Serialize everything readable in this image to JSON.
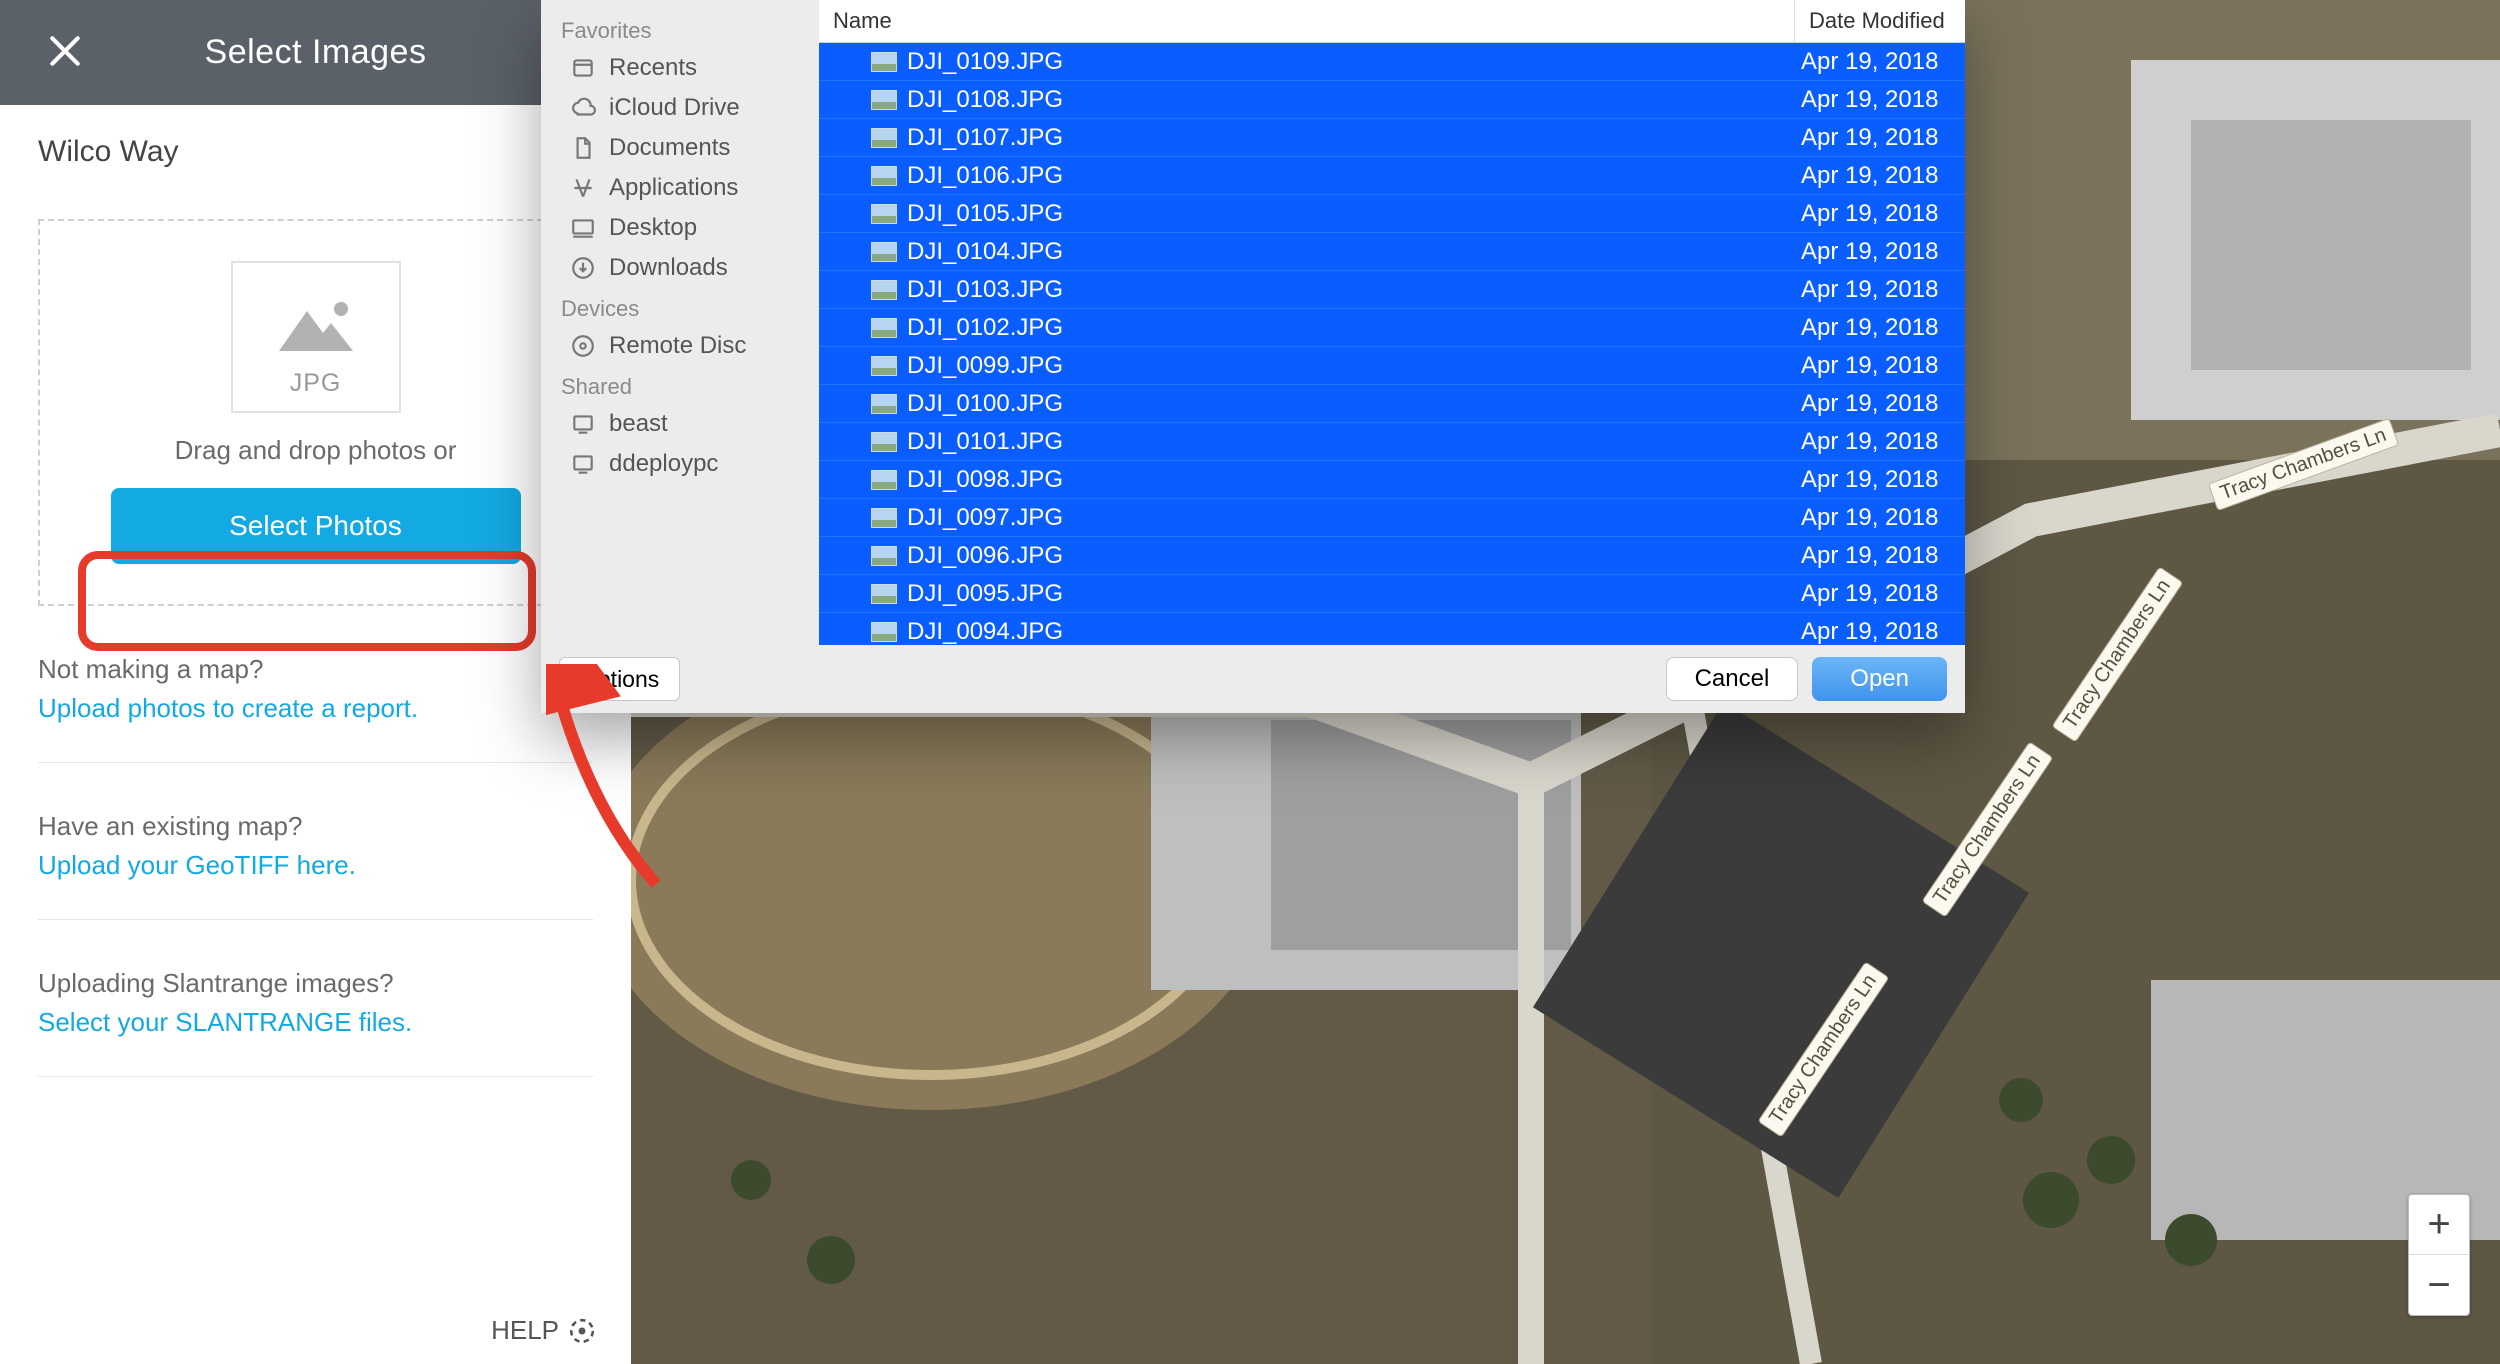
{
  "panel": {
    "title": "Select Images",
    "project": "Wilco Way",
    "filetype": "JPG",
    "drop_text": "Drag and drop photos or",
    "select_btn": "Select Photos",
    "blocks": [
      {
        "q": "Not making a map?",
        "link": "Upload photos to create a report."
      },
      {
        "q": "Have an existing map?",
        "link": "Upload your GeoTIFF here."
      },
      {
        "q": "Uploading Slantrange images?",
        "link": "Select your SLANTRANGE files."
      }
    ],
    "help": "HELP"
  },
  "dialog": {
    "cols": {
      "name": "Name",
      "date": "Date Modified"
    },
    "sidebar": {
      "favorites_title": "Favorites",
      "favorites": [
        "Recents",
        "iCloud Drive",
        "Documents",
        "Applications",
        "Desktop",
        "Downloads"
      ],
      "devices_title": "Devices",
      "devices": [
        "Remote Disc"
      ],
      "shared_title": "Shared",
      "shared": [
        "beast",
        "ddeploypc"
      ]
    },
    "files": [
      {
        "n": "DJI_0109.JPG",
        "d": "Apr 19, 2018"
      },
      {
        "n": "DJI_0108.JPG",
        "d": "Apr 19, 2018"
      },
      {
        "n": "DJI_0107.JPG",
        "d": "Apr 19, 2018"
      },
      {
        "n": "DJI_0106.JPG",
        "d": "Apr 19, 2018"
      },
      {
        "n": "DJI_0105.JPG",
        "d": "Apr 19, 2018"
      },
      {
        "n": "DJI_0104.JPG",
        "d": "Apr 19, 2018"
      },
      {
        "n": "DJI_0103.JPG",
        "d": "Apr 19, 2018"
      },
      {
        "n": "DJI_0102.JPG",
        "d": "Apr 19, 2018"
      },
      {
        "n": "DJI_0099.JPG",
        "d": "Apr 19, 2018"
      },
      {
        "n": "DJI_0100.JPG",
        "d": "Apr 19, 2018"
      },
      {
        "n": "DJI_0101.JPG",
        "d": "Apr 19, 2018"
      },
      {
        "n": "DJI_0098.JPG",
        "d": "Apr 19, 2018"
      },
      {
        "n": "DJI_0097.JPG",
        "d": "Apr 19, 2018"
      },
      {
        "n": "DJI_0096.JPG",
        "d": "Apr 19, 2018"
      },
      {
        "n": "DJI_0095.JPG",
        "d": "Apr 19, 2018"
      },
      {
        "n": "DJI_0094.JPG",
        "d": "Apr 19, 2018"
      }
    ],
    "buttons": {
      "options": "Options",
      "cancel": "Cancel",
      "open": "Open"
    }
  },
  "map": {
    "road_label": "Tracy Chambers Ln",
    "zoom_in": "+",
    "zoom_out": "−"
  }
}
